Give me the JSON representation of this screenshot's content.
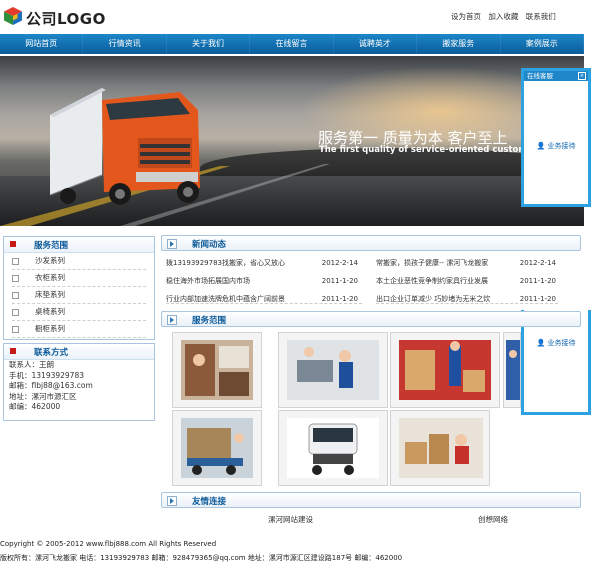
{
  "header": {
    "logo_text": "公司LOGO",
    "top_links": [
      "设为首页",
      "加入收藏",
      "联系我们"
    ]
  },
  "nav": {
    "items": [
      "网站首页",
      "行情资讯",
      "关于我们",
      "在线留言",
      "诚聘英才",
      "搬家服务",
      "案例展示"
    ]
  },
  "banner": {
    "slogan": "服务第一 质量为本 客户至上",
    "slogan_en": "The first quality of service-oriented customer first"
  },
  "online_service": {
    "title": "在线客服",
    "item": "业务接待"
  },
  "scope": {
    "title": "服务范围",
    "items": [
      "沙发系列",
      "衣柜系列",
      "床垫系列",
      "桌椅系列",
      "橱柜系列"
    ]
  },
  "contact": {
    "title": "联系方式",
    "lines": [
      "联系人：王朗",
      "手机：13193929783",
      "邮箱：flbj88@163.com",
      "地址：漯河市源汇区",
      "邮编：462000"
    ]
  },
  "news": {
    "title": "新闻动态",
    "left": [
      {
        "title": "拨13193929783找搬家，省心又放心",
        "date": "2012-2-14"
      },
      {
        "title": "稳住海外市场拓展国内市场",
        "date": "2011-1-20"
      },
      {
        "title": "行业内部加速洗牌危机中蕴含广阔前景",
        "date": "2011-1-20"
      }
    ],
    "right": [
      {
        "title": "常搬家，损孩子健康-- 漯河飞龙搬家",
        "date": "2012-2-14"
      },
      {
        "title": "本土企业恶性竞争制约家具行业发展",
        "date": "2011-1-20"
      },
      {
        "title": "出口企业订单减少 巧妙堵为无米之炊",
        "date": "2011-1-20"
      }
    ]
  },
  "services": {
    "title": "服务范围",
    "photos": [
      "movers-banner",
      "sofa-movers",
      "carton-movers",
      "moving-van-2",
      "loaded-truck",
      "white-truck",
      "family-boxes"
    ]
  },
  "links": {
    "title": "友情连接",
    "items": [
      "漯河网站建设",
      "创想网络"
    ]
  },
  "footer": {
    "copyright": "Copyright © 2005-2012 www.flbj888.com All Rights Reserved",
    "info": "版权所有：漯河飞龙搬家 电话：13193929783 邮箱：928479365@qq.com 地址：漯河市源汇区建设路187号 邮编：462000"
  },
  "colors": {
    "nav": "#0b5d9a",
    "accent": "#2da2e0",
    "heading": "#0c5a9a",
    "bullet": "#c81919"
  }
}
